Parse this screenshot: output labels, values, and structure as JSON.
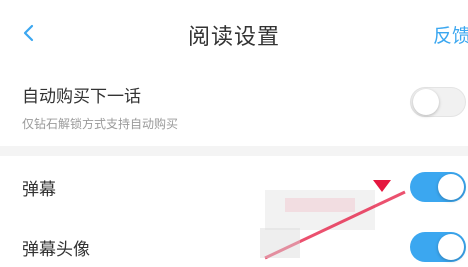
{
  "header": {
    "title": "阅读设置",
    "feedback_label": "反馈",
    "back_icon": "chevron-left-icon"
  },
  "settings": {
    "auto_buy": {
      "label": "自动购买下一话",
      "description": "仅钻石解锁方式支持自动购买",
      "enabled": false
    },
    "danmu": {
      "label": "弹幕",
      "enabled": true
    },
    "danmu_avatar": {
      "label": "弹幕头像",
      "enabled": true
    }
  },
  "colors": {
    "accent": "#3ba7f0",
    "toggle_on": "#3ba7f0",
    "toggle_off": "#f1f1f1",
    "divider": "#f4f4f4",
    "marker_red": "#e5173f"
  }
}
